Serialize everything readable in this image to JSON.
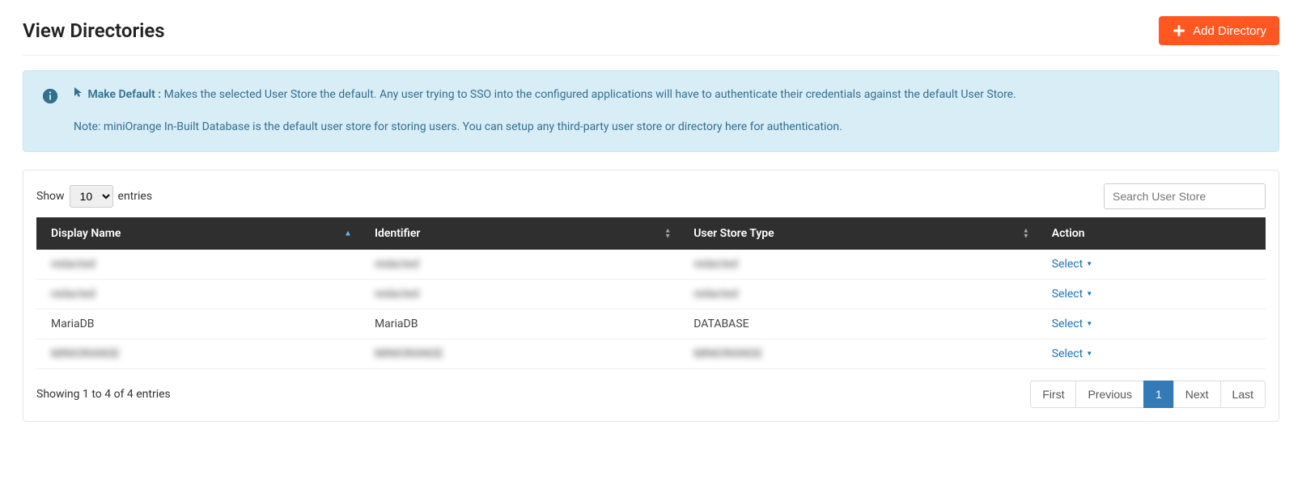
{
  "header": {
    "title": "View Directories",
    "add_button": "Add Directory"
  },
  "info": {
    "make_default_label": "Make Default :",
    "make_default_text": " Makes the selected User Store the default. Any user trying to SSO into the configured applications will have to authenticate their credentials against the default User Store.",
    "note": "Note: miniOrange In-Built Database is the default user store for storing users. You can setup any third-party user store or directory here for authentication."
  },
  "table": {
    "show_label_pre": "Show",
    "show_label_post": "entries",
    "show_value": "10",
    "search_placeholder": "Search User Store",
    "columns": {
      "display_name": "Display Name",
      "identifier": "Identifier",
      "user_store_type": "User Store Type",
      "action": "Action"
    },
    "rows": [
      {
        "display_name": "redacted",
        "identifier": "redacted",
        "user_store_type": "redacted",
        "blurred": true
      },
      {
        "display_name": "redacted",
        "identifier": "redacted",
        "user_store_type": "redacted",
        "blurred": true
      },
      {
        "display_name": "MariaDB",
        "identifier": "MariaDB",
        "user_store_type": "DATABASE",
        "blurred": false
      },
      {
        "display_name": "MINIORANGE",
        "identifier": "MINIORANGE",
        "user_store_type": "MINIORANGE",
        "blurred": true
      }
    ],
    "action_label": "Select",
    "footer_info": "Showing 1 to 4 of 4 entries",
    "pagination": {
      "first": "First",
      "previous": "Previous",
      "page": "1",
      "next": "Next",
      "last": "Last"
    }
  }
}
